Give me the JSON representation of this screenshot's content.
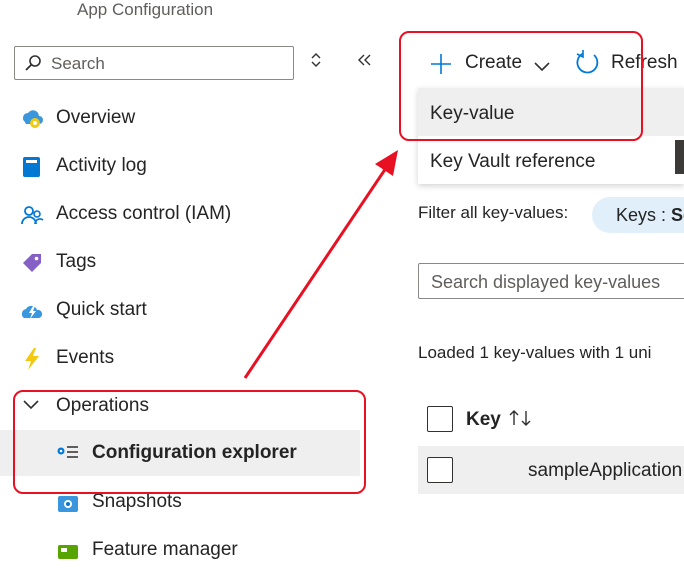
{
  "header": {
    "app_title": "App Configuration"
  },
  "search": {
    "placeholder": "Search"
  },
  "sidebar": {
    "items": [
      {
        "label": "Overview"
      },
      {
        "label": "Activity log"
      },
      {
        "label": "Access control (IAM)"
      },
      {
        "label": "Tags"
      },
      {
        "label": "Quick start"
      },
      {
        "label": "Events"
      },
      {
        "label": "Operations",
        "expanded": true
      },
      {
        "label": "Configuration explorer",
        "selected": true
      },
      {
        "label": "Snapshots"
      },
      {
        "label": "Feature manager"
      }
    ]
  },
  "toolbar": {
    "create_label": "Create",
    "refresh_label": "Refresh"
  },
  "create_menu": {
    "items": [
      {
        "label": "Key-value"
      },
      {
        "label": "Key Vault reference"
      }
    ]
  },
  "filter": {
    "label": "Filter all key-values:",
    "pill_key": "Keys : ",
    "pill_value": "Se"
  },
  "list": {
    "search_placeholder": "Search displayed key-values",
    "loaded_text": "Loaded 1 key-values with 1 uni",
    "column_key": "Key",
    "rows": [
      {
        "key": "sampleApplication"
      }
    ]
  },
  "colors": {
    "annotation": "#e81123",
    "accent": "#0078d4"
  },
  "icons": [
    "search-icon",
    "sort-updown-icon",
    "collapse-icon",
    "plus-icon",
    "chevron-down-icon",
    "refresh-icon"
  ]
}
